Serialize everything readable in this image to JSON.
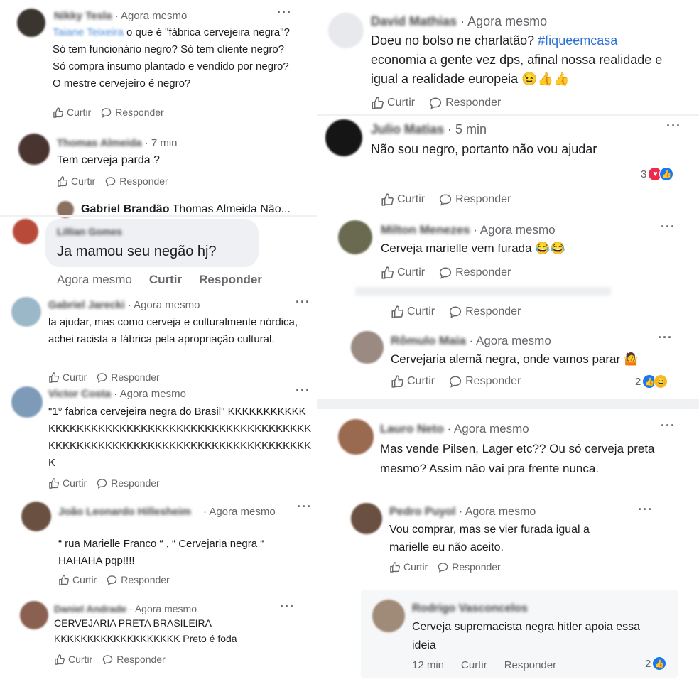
{
  "labels": {
    "like": "Curtir",
    "reply": "Responder"
  },
  "left": [
    {
      "name": "Nikky Tesla",
      "time": "· Agora mesmo",
      "mention": "Taiane Teixeira",
      "text": " o que é \"fábrica cervejeira negra\"? Só tem funcionário negro? Só tem cliente negro? Só compra insumo plantado e vendido por negro? O mestre cervejeiro é negro?"
    },
    {
      "name": "Thomas Almeida",
      "time": "· 7 min",
      "text": "Tem cerveja parda ?"
    },
    {
      "name": "Gabriel Brandão",
      "text": "Thomas Almeida Não..."
    },
    {
      "name": "Lillian Gomes",
      "time": "Agora mesmo",
      "text": "Ja mamou seu negão hj?"
    },
    {
      "name": "Gabriel Jarecki",
      "time": "· Agora mesmo",
      "text": "la ajudar, mas como cerveja e culturalmente nórdica, achei racista a fábrica pela apropriação cultural."
    },
    {
      "name": "Victor Costa",
      "time": "· Agora mesmo",
      "text": "\"1° fabrica cervejeira negra do Brasil\" KKKKKKKKKKKKKKKKKKKKKKKKKKKKKKKKKKKKKKKKKKKKKKKKKKKKKKKKKKKKKKKKKKKKKKKKKKKKKKKKKKKKKK"
    },
    {
      "name": "João Leonardo Hillesheim",
      "time": "· Agora mesmo",
      "text": "“ rua Marielle Franco “ , “ Cervejaria negra “ HAHAHA pqp!!!!"
    },
    {
      "name": "Daniel Andrade",
      "time": "· Agora mesmo",
      "text": "CERVEJARIA PRETA BRASILEIRA KKKKKKKKKKKKKKKKKKK Preto é foda"
    }
  ],
  "right": [
    {
      "name": "David Mathias",
      "time": "· Agora mesmo",
      "text": "Doeu no bolso ne charlatão? ",
      "hashtag": "#fiqueemcasa",
      "text2": " economia a gente vez dps, afinal nossa realidade e igual a realidade europeia 😉👍👍"
    },
    {
      "name": "Julio Matias",
      "time": "· 5 min",
      "text": "Não sou negro, portanto não vou ajudar",
      "reactions": "3"
    },
    {
      "name": "Milton Menezes",
      "time": "· Agora mesmo",
      "text": "Cerveja marielle vem furada 😂😂"
    },
    {
      "name": "Rômulo Maia",
      "time": "· Agora mesmo",
      "text": "Cervejaria alemã negra, onde vamos parar 🤷",
      "reactions": "2"
    },
    {
      "name": "Lauro Neto",
      "time": "· Agora mesmo",
      "text": "Mas vende Pilsen, Lager etc?? Ou só cerveja preta mesmo? Assim não vai pra frente nunca."
    },
    {
      "name": "Pedro Puyol",
      "time": "· Agora mesmo",
      "text": "Vou comprar, mas se vier furada igual a marielle eu não aceito."
    },
    {
      "name": "Rodrigo Vasconcelos",
      "time": "12 min",
      "text": "Cerveja supremacista negra hitler apoia essa ideia",
      "reactions": "2"
    }
  ],
  "colors": {
    "link": "#4a8ad6",
    "meta": "#65676b",
    "like": "#1877f2",
    "love": "#f02849"
  }
}
